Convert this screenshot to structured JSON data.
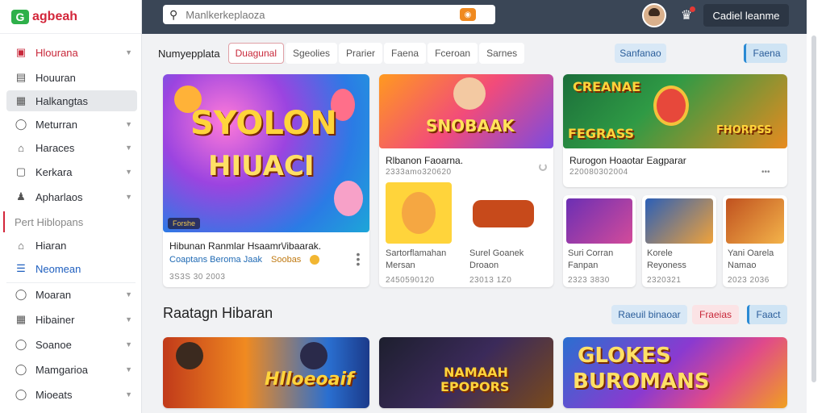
{
  "app": {
    "logo_mark": "G",
    "logo_text": "agbeah"
  },
  "search": {
    "placeholder": "Manlkerkeplaoza",
    "badge_icon": "gift-icon"
  },
  "topbar": {
    "cta_label": "Cadiel leanme"
  },
  "sidebar": {
    "items": [
      {
        "label": "Hlourana",
        "icon": "games-icon"
      },
      {
        "label": "Houuran",
        "icon": "calendar-icon"
      },
      {
        "label": "Halkangtas",
        "icon": "image-icon"
      },
      {
        "label": "Meturran",
        "icon": "clock-icon"
      },
      {
        "label": "Haraces",
        "icon": "shop-icon"
      },
      {
        "label": "Kerkara",
        "icon": "box-icon"
      },
      {
        "label": "Apharlaos",
        "icon": "user-icon"
      }
    ],
    "section_label": "Pert Hiblopans",
    "items2": [
      {
        "label": "Hiaran",
        "icon": "home-icon"
      },
      {
        "label": "Neomean",
        "icon": "list-icon"
      },
      {
        "label": "Moaran",
        "icon": "compass-icon"
      },
      {
        "label": "Hibainer",
        "icon": "grid-icon"
      },
      {
        "label": "Soanoe",
        "icon": "globe-icon"
      },
      {
        "label": "Mamgarioa",
        "icon": "heart-icon"
      },
      {
        "label": "Mioeats",
        "icon": "settings-icon"
      }
    ]
  },
  "tabs": {
    "title": "Numyepplata",
    "items": [
      "Duagunal",
      "Sgeolies",
      "Prarier",
      "Faena",
      "Fceroan",
      "Sarnes"
    ],
    "pill_left": "Sanfanao",
    "pill_right": "Faena"
  },
  "cards": {
    "hero": {
      "art_text_1": "SYOLON",
      "art_text_2": "HIUACI",
      "tag": "Forshe",
      "title": "Hibunan Ranmlar Hsaamr\\/ibaarak.",
      "sub_link": "Coaptans Beroma Jaak",
      "sub_gold": "Soobas",
      "sub_icon": "coin-icon",
      "date": "3S3S 30 2003"
    },
    "middle": {
      "art_text": "SNOBAAK",
      "title": "Rlbanon Faoarna.",
      "date": "2333amo320620",
      "sub1_title": "Sartorflamahan",
      "sub1_sub": "Mersan",
      "sub1_date": "2450590120",
      "sub2_title": "Surel Goanek",
      "sub2_sub": "Droaon",
      "sub2_date": "23013 1Z0"
    },
    "right": {
      "art_text_1": "CREANAE",
      "art_text_2": "FEGRASS",
      "art_text_3": "FHORPSS",
      "title": "Rurogon Hoaotar Eagparar",
      "date": "220080302004",
      "mini1_title": "Suri Corran",
      "mini1_sub": "Fanpan",
      "mini1_date": "2323 3830",
      "mini2_title": "Korele",
      "mini2_sub": "Reyoness",
      "mini2_date": "2320321",
      "mini3_title": "Yani Oarela",
      "mini3_sub": "Namao",
      "mini3_date": "2023 2036"
    }
  },
  "section2": {
    "title": "Raatagn Hibaran",
    "pill1": "Raeuil binaoar",
    "pill2": "Fraeias",
    "pill3": "Faact"
  },
  "bottom_cards": {
    "card1_text": "Hlloeoaif",
    "card2_text_1": "NAMAAH",
    "card2_text_2": "EPOPORS",
    "card3_text_1": "GLOKES",
    "card3_text_2": "BUROMANS"
  }
}
